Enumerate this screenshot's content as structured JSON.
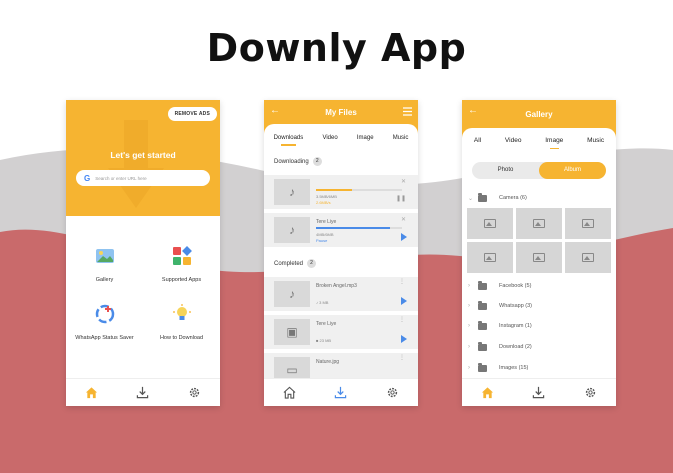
{
  "title": "Downly App",
  "colors": {
    "accent": "#f6b431",
    "wave_grey": "#d2d0d1",
    "wave_red": "#c96a6b",
    "link_blue": "#4a8be8"
  },
  "home": {
    "remove_ads": "REMOVE ADS",
    "heading": "Let's get started",
    "search_placeholder": "Search or enter URL here",
    "google_icon": "google-icon",
    "features": [
      {
        "label": "Gallery",
        "icon": "gallery-icon"
      },
      {
        "label": "Supported Apps",
        "icon": "apps-icon"
      },
      {
        "label": "WhatsApp Status Saver",
        "icon": "status-saver-icon"
      },
      {
        "label": "How to Download",
        "icon": "bulb-icon"
      }
    ]
  },
  "files": {
    "title": "My Files",
    "tabs": [
      "Downloads",
      "Video",
      "Image",
      "Music"
    ],
    "active_tab": "Downloads",
    "downloading_label": "Downloading",
    "downloading_count": "2",
    "completed_label": "Completed",
    "completed_count": "2",
    "downloading": [
      {
        "name": "",
        "size": "3.5MB/6MB",
        "status": "2.6MB/s",
        "progress": 0.42,
        "color": "#f6b431"
      },
      {
        "name": "Tere Liye",
        "size": "4MB/6MB",
        "status": "Pause",
        "progress": 0.86,
        "color": "#4a8be8"
      }
    ],
    "completed": [
      {
        "name": "Broken Angel.mp3",
        "meta": "3 MB"
      },
      {
        "name": "Tere Liye",
        "meta": "23 MB"
      },
      {
        "name": "Nature.jpg",
        "meta": ""
      }
    ]
  },
  "gallery": {
    "title": "Gallery",
    "tabs": [
      "All",
      "Video",
      "Image",
      "Music"
    ],
    "active_tab": "Image",
    "toggle": {
      "photo": "Photo",
      "album": "Album"
    },
    "active_toggle": "Album",
    "folders": [
      {
        "name": "Camera (6)",
        "expanded": true
      },
      {
        "name": "Facebook (5)"
      },
      {
        "name": "Whatsapp (3)"
      },
      {
        "name": "Instagram (1)"
      },
      {
        "name": "Download (2)"
      },
      {
        "name": "Images (15)"
      }
    ],
    "thumbnail_count": 6
  }
}
